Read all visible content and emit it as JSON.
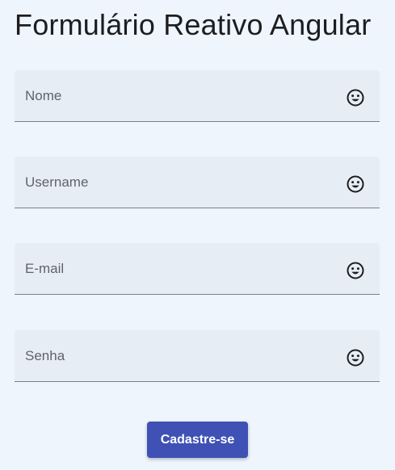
{
  "form": {
    "title": "Formulário Reativo Angular",
    "fields": [
      {
        "label": "Nome",
        "value": "",
        "icon": "smiley-icon"
      },
      {
        "label": "Username",
        "value": "",
        "icon": "smiley-icon"
      },
      {
        "label": "E-mail",
        "value": "",
        "icon": "smiley-icon"
      },
      {
        "label": "Senha",
        "value": "",
        "icon": "smiley-icon"
      }
    ],
    "submit_label": "Cadastre-se"
  },
  "colors": {
    "background": "#eef5fd",
    "field_background": "#e7edf5",
    "primary": "#3f51b5"
  }
}
